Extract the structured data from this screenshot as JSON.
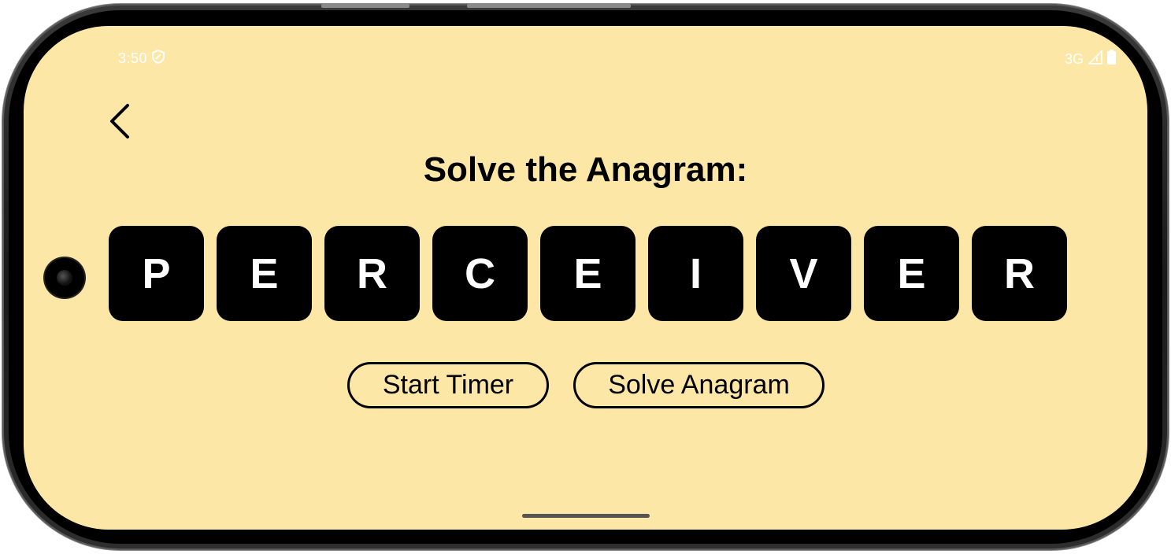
{
  "status_bar": {
    "time": "3:50",
    "network": "3G",
    "icons": [
      "shield-icon",
      "signal-icon",
      "battery-icon"
    ]
  },
  "header": {
    "back_icon": "chevron-left-icon"
  },
  "main": {
    "title": "Solve the Anagram:",
    "letters": [
      "P",
      "E",
      "R",
      "C",
      "E",
      "I",
      "V",
      "E",
      "R"
    ],
    "buttons": {
      "start_timer": "Start Timer",
      "solve_anagram": "Solve Anagram"
    }
  },
  "colors": {
    "background": "#fde7a6",
    "tile": "#000000",
    "tile_text": "#ffffff",
    "text": "#000000"
  }
}
